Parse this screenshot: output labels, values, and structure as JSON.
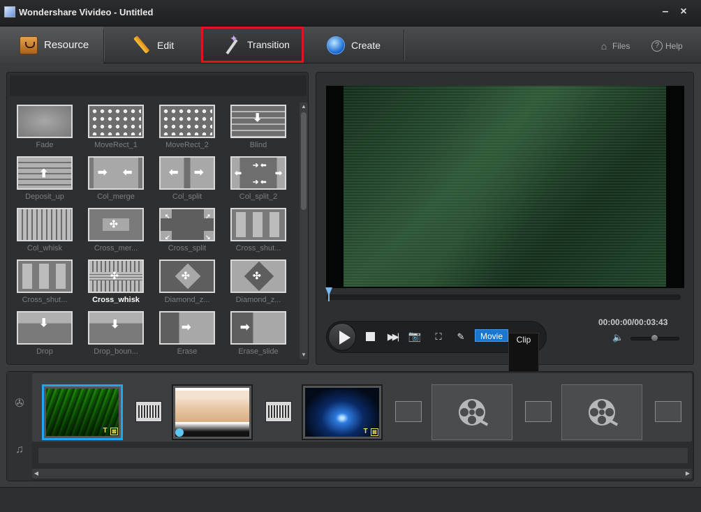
{
  "window": {
    "title": "Wondershare Vivideo - Untitled"
  },
  "toolbar": {
    "tabs": [
      {
        "label": "Resource"
      },
      {
        "label": "Edit"
      },
      {
        "label": "Transition"
      },
      {
        "label": "Create"
      }
    ],
    "files_label": "Files",
    "help_label": "Help"
  },
  "transitions": [
    {
      "name": "Fade"
    },
    {
      "name": "MoveRect_1"
    },
    {
      "name": "MoveRect_2"
    },
    {
      "name": "Blind"
    },
    {
      "name": "Deposit_up"
    },
    {
      "name": "Col_merge"
    },
    {
      "name": "Col_split"
    },
    {
      "name": "Col_split_2"
    },
    {
      "name": "Col_whisk"
    },
    {
      "name": "Cross_mer..."
    },
    {
      "name": "Cross_split"
    },
    {
      "name": "Cross_shut..."
    },
    {
      "name": "Cross_shut..."
    },
    {
      "name": "Cross_whisk"
    },
    {
      "name": "Diamond_z..."
    },
    {
      "name": "Diamond_z..."
    },
    {
      "name": "Drop"
    },
    {
      "name": "Drop_boun..."
    },
    {
      "name": "Erase"
    },
    {
      "name": "Erase_slide"
    }
  ],
  "selected_transition": "Cross_whisk",
  "player": {
    "timecode": "00:00:00/00:03:43",
    "progress": 0,
    "volume": 0.5,
    "mode_movie": "Movie",
    "mode_clip": "Clip"
  },
  "accent_colors": {
    "highlight_red": "#e0141e",
    "selection_blue": "#20a6ea",
    "mode_blue": "#1a76d1"
  }
}
